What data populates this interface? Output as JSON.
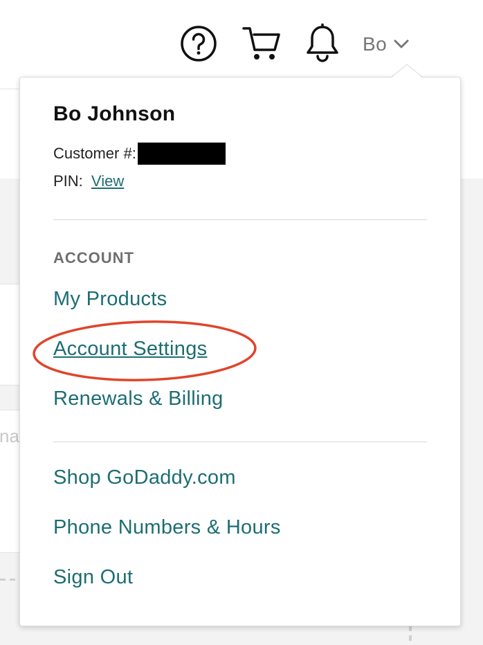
{
  "header": {
    "help_icon": "question-circle-icon",
    "cart_icon": "shopping-cart-icon",
    "bell_icon": "notification-bell-icon",
    "user_label": "Bo",
    "chevron_icon": "chevron-down-icon"
  },
  "background": {
    "partial_text": "na"
  },
  "dropdown": {
    "profile_name": "Bo Johnson",
    "customer_label": "Customer #:",
    "pin_label": "PIN:",
    "pin_link": "View",
    "section_heading": "ACCOUNT",
    "account_links": [
      "My Products",
      "Account Settings",
      "Renewals & Billing"
    ],
    "other_links": [
      "Shop GoDaddy.com",
      "Phone Numbers & Hours",
      "Sign Out"
    ],
    "highlight_color": "#e0442b"
  },
  "colors": {
    "link": "#1c6d74",
    "heading": "#6f6f6f",
    "text": "#111111",
    "highlight": "#e0442b"
  }
}
